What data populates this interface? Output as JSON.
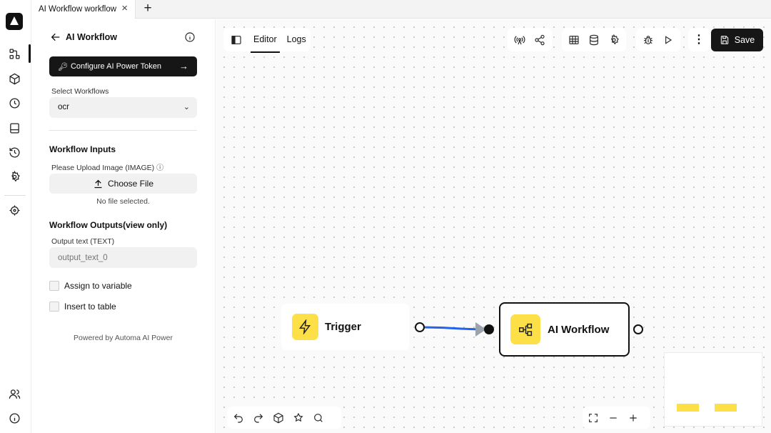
{
  "tab": {
    "title": "AI Workflow workflow",
    "close": "×",
    "add": "+"
  },
  "panel": {
    "title": "AI Workflow",
    "token_button": "Configure AI Power Token",
    "select_label": "Select Workflows",
    "select_value": "ocr",
    "inputs_heading": "Workflow Inputs",
    "upload_label": "Please Upload Image (IMAGE)",
    "choose_file": "Choose File",
    "no_file": "No file selected.",
    "outputs_heading": "Workflow Outputs(view only)",
    "output_label": "Output text (TEXT)",
    "output_placeholder": "output_text_0",
    "assign_variable": "Assign to variable",
    "insert_table": "Insert to table",
    "powered_by": "Powered by Automa AI Power"
  },
  "toolbar": {
    "editor_tab": "Editor",
    "logs_tab": "Logs",
    "save": "Save"
  },
  "nodes": {
    "trigger": "Trigger",
    "ai_workflow": "AI Workflow"
  },
  "colors": {
    "accent_yellow": "#fde047",
    "edge_blue": "#2563eb",
    "dark": "#161616"
  }
}
